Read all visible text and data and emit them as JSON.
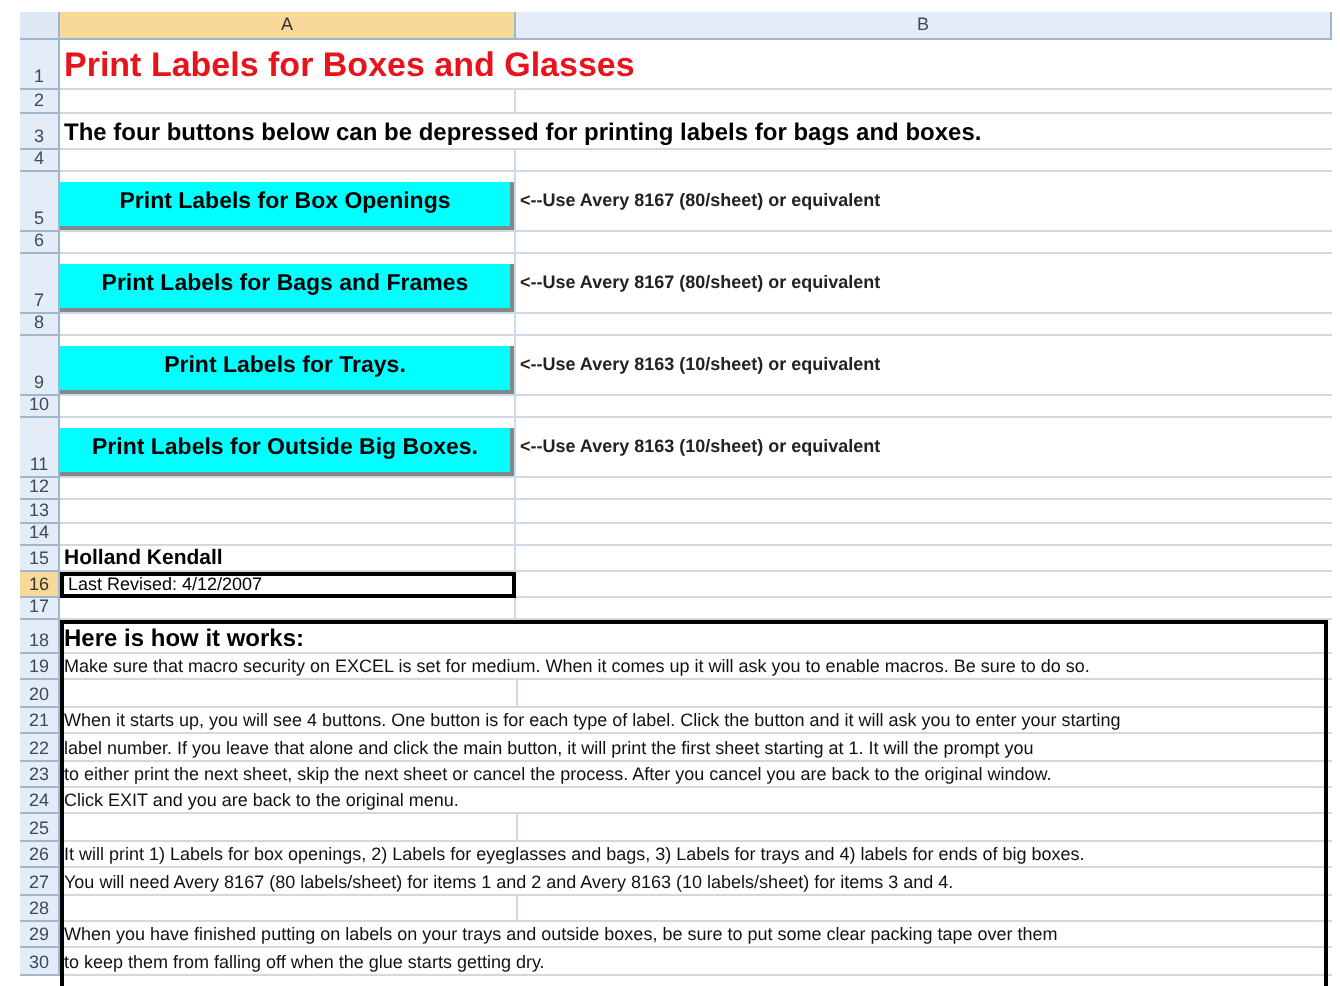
{
  "columns": [
    {
      "label": "A",
      "selected": true
    },
    {
      "label": "B",
      "selected": false
    }
  ],
  "rows": [
    {
      "number": "1",
      "kind": "title",
      "text": "Print Labels for Boxes and Glasses",
      "selected": false
    },
    {
      "number": "2",
      "kind": "empty",
      "selected": false
    },
    {
      "number": "3",
      "kind": "intro",
      "text": "The four buttons below can be depressed for printing labels for bags and boxes.",
      "selected": false
    },
    {
      "number": "4",
      "kind": "empty",
      "selected": false
    },
    {
      "number": "5",
      "kind": "button",
      "label": "Print Labels for Box Openings",
      "note": "<--Use Avery 8167 (80/sheet) or equivalent",
      "selected": false
    },
    {
      "number": "6",
      "kind": "empty",
      "selected": false
    },
    {
      "number": "7",
      "kind": "button",
      "label": "Print Labels for Bags and Frames",
      "note": "<--Use Avery 8167 (80/sheet) or equivalent",
      "selected": false
    },
    {
      "number": "8",
      "kind": "empty",
      "selected": false
    },
    {
      "number": "9",
      "kind": "button",
      "label": "Print Labels for Trays.",
      "note": "<--Use Avery 8163 (10/sheet) or equivalent",
      "selected": false
    },
    {
      "number": "10",
      "kind": "empty",
      "selected": false
    },
    {
      "number": "11",
      "kind": "button",
      "label": "Print Labels for Outside Big Boxes.",
      "note": "<--Use Avery 8163 (10/sheet) or equivalent",
      "selected": false
    },
    {
      "number": "12",
      "kind": "empty",
      "selected": false
    },
    {
      "number": "13",
      "kind": "empty",
      "selected": false
    },
    {
      "number": "14",
      "kind": "empty",
      "selected": false
    },
    {
      "number": "15",
      "kind": "author",
      "text": "Holland Kendall",
      "selected": false
    },
    {
      "number": "16",
      "kind": "text",
      "text": "Last Revised:  4/12/2007",
      "selected": true
    },
    {
      "number": "17",
      "kind": "empty",
      "selected": false
    }
  ],
  "instructions_box": {
    "rows": [
      {
        "number": "18",
        "kind": "heading",
        "text": "Here is how it works:"
      },
      {
        "number": "19",
        "kind": "text",
        "text": "Make sure that macro security on EXCEL is set for medium.  When it comes up it will ask you to enable macros.  Be sure to do so."
      },
      {
        "number": "20",
        "kind": "empty"
      },
      {
        "number": "21",
        "kind": "text",
        "text": "When it starts up, you will see 4 buttons.  One button is for each type of label.  Click the button and it will ask you to enter your starting"
      },
      {
        "number": "22",
        "kind": "text",
        "text": "label number.  If you leave that alone and click the main button, it will print the first sheet starting at 1.  It will the prompt you"
      },
      {
        "number": "23",
        "kind": "text",
        "text": "to either print the next sheet, skip the next sheet or cancel the process.  After you cancel you are back to the original window."
      },
      {
        "number": "24",
        "kind": "text",
        "text": "Click EXIT and you are back to the original menu."
      },
      {
        "number": "25",
        "kind": "empty"
      },
      {
        "number": "26",
        "kind": "text",
        "text": "It will print 1) Labels for box openings, 2) Labels for eyeglasses and bags, 3) Labels for trays and 4) labels for ends of big boxes."
      },
      {
        "number": "27",
        "kind": "text",
        "text": "You will need Avery 8167 (80 labels/sheet) for items 1 and 2 and Avery 8163 (10 labels/sheet) for items 3 and 4."
      },
      {
        "number": "28",
        "kind": "empty"
      },
      {
        "number": "29",
        "kind": "text",
        "text": "When you have finished putting on labels on your trays and outside boxes, be sure to put some clear packing tape over them"
      },
      {
        "number": "30",
        "kind": "text",
        "text": "to keep them from falling off when the glue starts getting dry."
      }
    ]
  }
}
